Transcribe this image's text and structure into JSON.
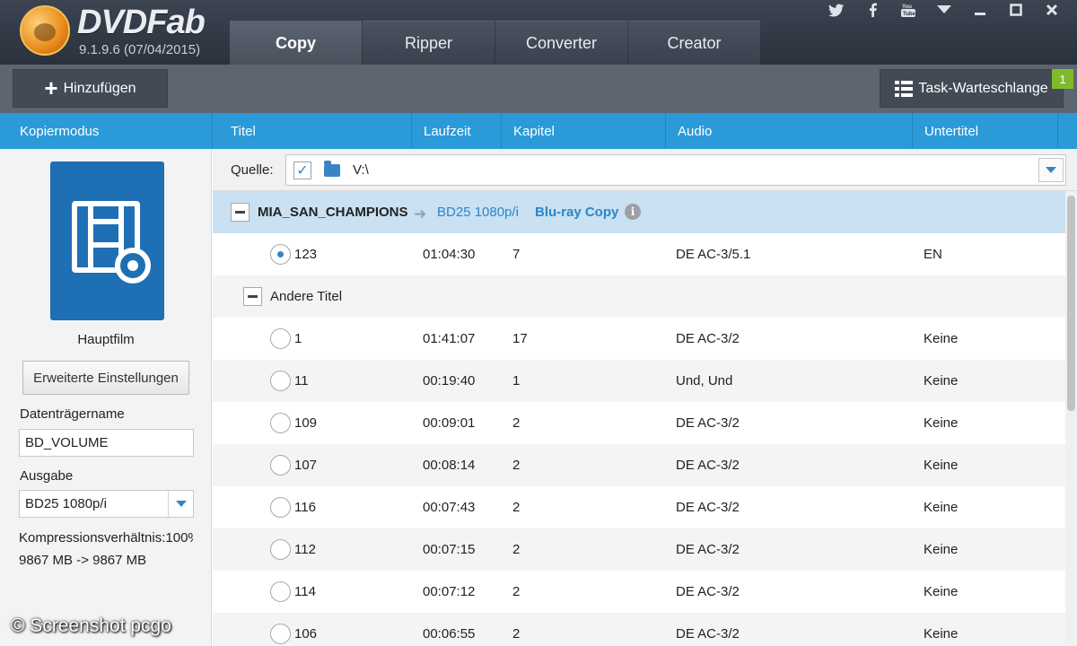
{
  "app": {
    "brand": "DVDFab",
    "version": "9.1.9.6 (07/04/2015)",
    "tabs": [
      {
        "label": "Copy",
        "active": true
      },
      {
        "label": "Ripper",
        "active": false
      },
      {
        "label": "Converter",
        "active": false
      },
      {
        "label": "Creator",
        "active": false
      }
    ],
    "window_controls": [
      "twitter-icon",
      "facebook-icon",
      "youtube-icon",
      "menu-dropdown-icon",
      "minimize-icon",
      "maximize-icon",
      "close-icon"
    ]
  },
  "toolbar": {
    "add_label": "Hinzufügen",
    "queue_label": "Task-Warteschlange",
    "queue_count": "1"
  },
  "columns": {
    "mode": "Kopiermodus",
    "title": "Titel",
    "runtime": "Laufzeit",
    "chapters": "Kapitel",
    "audio": "Audio",
    "subtitles": "Untertitel"
  },
  "sidebar": {
    "mode_name": "Hauptfilm",
    "advanced_button": "Erweiterte Einstellungen",
    "volume_label": "Datenträgername",
    "volume_value": "BD_VOLUME",
    "output_label": "Ausgabe",
    "output_value": "BD25 1080p/i",
    "compression": "Kompressionsverhältnis:100%",
    "size": "9867 MB -> 9867 MB"
  },
  "source": {
    "label": "Quelle:",
    "path": "V:\\",
    "checked": true
  },
  "disc": {
    "name": "MIA_SAN_CHAMPIONS",
    "format": "BD25 1080p/i",
    "mode": "Blu-ray Copy",
    "info_icon": "i"
  },
  "main_title": {
    "title": "123",
    "runtime": "01:04:30",
    "chapters": "7",
    "audio": "DE AC-3/5.1",
    "subtitles": "EN",
    "selected": true
  },
  "other_titles_label": "Andere Titel",
  "other_titles": [
    {
      "title": "1",
      "runtime": "01:41:07",
      "chapters": "17",
      "audio": "DE AC-3/2",
      "subtitles": "Keine"
    },
    {
      "title": "11",
      "runtime": "00:19:40",
      "chapters": "1",
      "audio": "Und, Und",
      "subtitles": "Keine"
    },
    {
      "title": "109",
      "runtime": "00:09:01",
      "chapters": "2",
      "audio": "DE AC-3/2",
      "subtitles": "Keine"
    },
    {
      "title": "107",
      "runtime": "00:08:14",
      "chapters": "2",
      "audio": "DE AC-3/2",
      "subtitles": "Keine"
    },
    {
      "title": "116",
      "runtime": "00:07:43",
      "chapters": "2",
      "audio": "DE AC-3/2",
      "subtitles": "Keine"
    },
    {
      "title": "112",
      "runtime": "00:07:15",
      "chapters": "2",
      "audio": "DE AC-3/2",
      "subtitles": "Keine"
    },
    {
      "title": "114",
      "runtime": "00:07:12",
      "chapters": "2",
      "audio": "DE AC-3/2",
      "subtitles": "Keine"
    },
    {
      "title": "106",
      "runtime": "00:06:55",
      "chapters": "2",
      "audio": "DE AC-3/2",
      "subtitles": "Keine"
    }
  ],
  "watermark": "© Screenshot pcgo",
  "colors": {
    "accent": "#2a9ad8",
    "selected_row": "#c9e1f2",
    "badge": "#7dbb2c"
  }
}
